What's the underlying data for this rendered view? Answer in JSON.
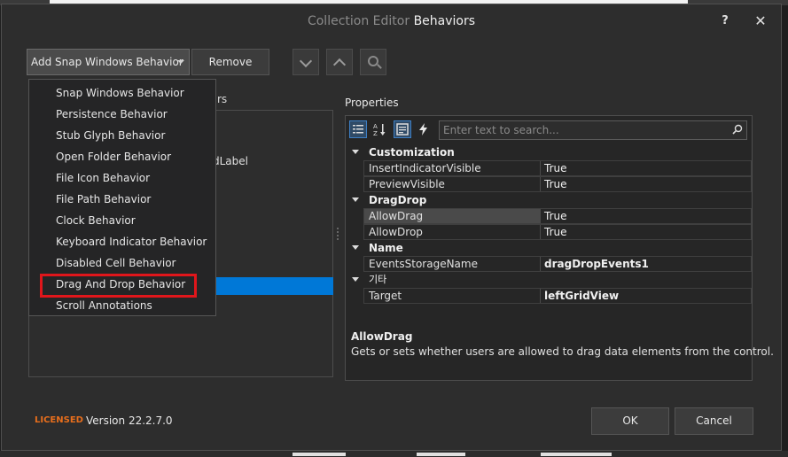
{
  "window": {
    "title_prefix": "Collection Editor",
    "title_main": "Behaviors",
    "help_label": "?",
    "close_label": "✕"
  },
  "toolbar": {
    "add_label": "Add Snap Windows Behavior",
    "remove_label": "Remove"
  },
  "dropdown": {
    "items": [
      "Snap Windows Behavior",
      "Persistence Behavior",
      "Stub Glyph Behavior",
      "Open Folder Behavior",
      "File Icon Behavior",
      "File Path Behavior",
      "Clock Behavior",
      "Keyboard Indicator Behavior",
      "Disabled Cell Behavior",
      "Drag And Drop Behavior",
      "Scroll Annotations"
    ],
    "highlighted": "Drag And Drop Behavior"
  },
  "members": {
    "partial_label": "rs",
    "partial_item": "dLabel"
  },
  "properties": {
    "label": "Properties",
    "search_placeholder": "Enter text to search...",
    "categories": [
      {
        "name": "Customization",
        "rows": [
          {
            "name": "InsertIndicatorVisible",
            "value": "True",
            "bold": false
          },
          {
            "name": "PreviewVisible",
            "value": "True",
            "bold": false
          }
        ]
      },
      {
        "name": "DragDrop",
        "rows": [
          {
            "name": "AllowDrag",
            "value": "True",
            "bold": false,
            "selected": true
          },
          {
            "name": "AllowDrop",
            "value": "True",
            "bold": false
          }
        ]
      },
      {
        "name": "Name",
        "rows": [
          {
            "name": "EventsStorageName",
            "value": "dragDropEvents1",
            "bold": true
          }
        ]
      },
      {
        "name": "기타",
        "rows": [
          {
            "name": "Target",
            "value": "leftGridView",
            "bold": true
          }
        ]
      }
    ],
    "description_title": "AllowDrag",
    "description_text": "Gets or sets whether users are allowed to drag data elements from the control."
  },
  "footer": {
    "licensed": "LICENSED",
    "version": "Version 22.2.7.0",
    "ok_label": "OK",
    "cancel_label": "Cancel"
  },
  "colors": {
    "accent": "#0078d7",
    "highlight_border": "#e0161b",
    "licensed": "#e86e1c"
  }
}
